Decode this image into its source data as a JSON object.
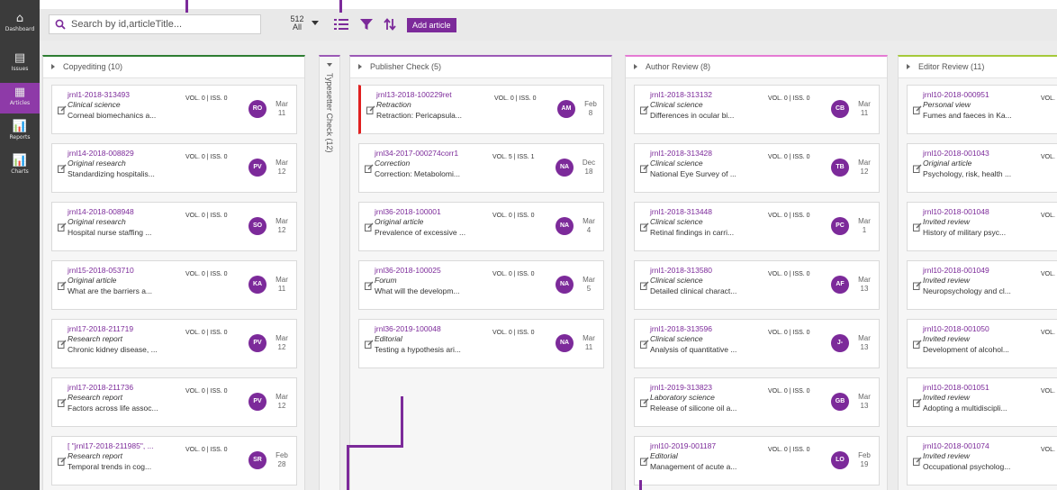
{
  "sidebar": {
    "items": [
      {
        "label": "Dashboard",
        "icon": "home-icon",
        "glyph": "⌂",
        "active": false
      },
      {
        "label": "Issues",
        "icon": "issues-icon",
        "glyph": "▤",
        "active": false
      },
      {
        "label": "Articles",
        "icon": "articles-icon",
        "glyph": "▦",
        "active": true
      },
      {
        "label": "Reports",
        "icon": "reports-icon",
        "glyph": "📊",
        "active": false
      },
      {
        "label": "Charts",
        "icon": "charts-icon",
        "glyph": "📊",
        "active": false
      }
    ]
  },
  "toolbar": {
    "search_placeholder": "Search by id,articleTitle...",
    "count_value": "512",
    "count_filter": "All",
    "add_label": "Add article"
  },
  "columns": [
    {
      "title": "Copyediting (10)",
      "accent": "#2e7d32",
      "cards": [
        {
          "id": "jrnl1-2018-313493",
          "type": "Clinical science",
          "title": "Corneal biomechanics a...",
          "vol": "VOL. 0 | ISS. 0",
          "avatar": "RO",
          "month": "Mar",
          "day": "11"
        },
        {
          "id": "jrnl14-2018-008829",
          "type": "Original research",
          "title": "Standardizing hospitalis...",
          "vol": "VOL. 0 | ISS. 0",
          "avatar": "PV",
          "month": "Mar",
          "day": "12"
        },
        {
          "id": "jrnl14-2018-008948",
          "type": "Original research",
          "title": "Hospital nurse staffing ...",
          "vol": "VOL. 0 | ISS. 0",
          "avatar": "SO",
          "month": "Mar",
          "day": "12"
        },
        {
          "id": "jrnl15-2018-053710",
          "type": "Original article",
          "title": "What are the barriers a...",
          "vol": "VOL. 0 | ISS. 0",
          "avatar": "KA",
          "month": "Mar",
          "day": "11"
        },
        {
          "id": "jrnl17-2018-211719",
          "type": "Research report",
          "title": "Chronic kidney disease, ...",
          "vol": "VOL. 0 | ISS. 0",
          "avatar": "PV",
          "month": "Mar",
          "day": "12"
        },
        {
          "id": "jrnl17-2018-211736",
          "type": "Research report",
          "title": "Factors across life assoc...",
          "vol": "VOL. 0 | ISS. 0",
          "avatar": "PV",
          "month": "Mar",
          "day": "12"
        },
        {
          "id": "[ \"jrnl17-2018-211985\", ...",
          "type": "Research report",
          "title": "Temporal trends in cog...",
          "vol": "VOL. 0 | ISS. 0",
          "avatar": "SR",
          "month": "Feb",
          "day": "28"
        }
      ]
    },
    {
      "title": "Publisher Check (5)",
      "accent": "#9b59b6",
      "cards": [
        {
          "id": "jrnl13-2018-100229ret",
          "type": "Retraction",
          "title": "Retraction: Pericapsula...",
          "vol": "VOL. 0 | ISS. 0",
          "avatar": "AM",
          "month": "Feb",
          "day": "8",
          "flag": true
        },
        {
          "id": "jrnl34-2017-000274corr1",
          "type": "Correction",
          "title": "Correction: Metabolomi...",
          "vol": "VOL. 5 | ISS. 1",
          "avatar": "NA",
          "month": "Dec",
          "day": "18"
        },
        {
          "id": "jrnl36-2018-100001",
          "type": "Original article",
          "title": "Prevalence of excessive ...",
          "vol": "VOL. 0 | ISS. 0",
          "avatar": "NA",
          "month": "Mar",
          "day": "4"
        },
        {
          "id": "jrnl36-2018-100025",
          "type": "Forum",
          "title": "What will the developm...",
          "vol": "VOL. 0 | ISS. 0",
          "avatar": "NA",
          "month": "Mar",
          "day": "5"
        },
        {
          "id": "jrnl36-2019-100048",
          "type": "Editorial",
          "title": "Testing a hypothesis ari...",
          "vol": "VOL. 0 | ISS. 0",
          "avatar": "NA",
          "month": "Mar",
          "day": "11"
        }
      ]
    },
    {
      "title": "Author Review (8)",
      "accent": "#e57bd3",
      "cards": [
        {
          "id": "jrnl1-2018-313132",
          "type": "Clinical science",
          "title": "Differences in ocular bi...",
          "vol": "VOL. 0 | ISS. 0",
          "avatar": "CB",
          "month": "Mar",
          "day": "11"
        },
        {
          "id": "jrnl1-2018-313428",
          "type": "Clinical science",
          "title": "National Eye Survey of ...",
          "vol": "VOL. 0 | ISS. 0",
          "avatar": "TB",
          "month": "Mar",
          "day": "12"
        },
        {
          "id": "jrnl1-2018-313448",
          "type": "Clinical science",
          "title": "Retinal findings in carri...",
          "vol": "VOL. 0 | ISS. 0",
          "avatar": "PC",
          "month": "Mar",
          "day": "1"
        },
        {
          "id": "jrnl1-2018-313580",
          "type": "Clinical science",
          "title": "Detailed clinical charact...",
          "vol": "VOL. 0 | ISS. 0",
          "avatar": "AF",
          "month": "Mar",
          "day": "13"
        },
        {
          "id": "jrnl1-2018-313596",
          "type": "Clinical science",
          "title": "Analysis of quantitative ...",
          "vol": "VOL. 0 | ISS. 0",
          "avatar": "J-",
          "month": "Mar",
          "day": "13"
        },
        {
          "id": "jrnl1-2019-313823",
          "type": "Laboratory science",
          "title": "Release of silicone oil a...",
          "vol": "VOL. 0 | ISS. 0",
          "avatar": "GB",
          "month": "Mar",
          "day": "13"
        },
        {
          "id": "jrnl10-2019-001187",
          "type": "Editorial",
          "title": "Management of acute a...",
          "vol": "VOL. 0 | ISS. 0",
          "avatar": "LO",
          "month": "Feb",
          "day": "19"
        }
      ]
    },
    {
      "title": "Editor Review (11)",
      "accent": "#a5c93a",
      "cards": [
        {
          "id": "jrnl10-2018-000951",
          "type": "Personal view",
          "title": "Fumes and faeces in Ka...",
          "vol": "VOL.",
          "avatar": "",
          "month": "",
          "day": ""
        },
        {
          "id": "jrnl10-2018-001043",
          "type": "Original article",
          "title": "Psychology, risk, health ...",
          "vol": "VOL.",
          "avatar": "",
          "month": "",
          "day": ""
        },
        {
          "id": "jrnl10-2018-001048",
          "type": "Invited review",
          "title": "History of military psyc...",
          "vol": "VOL.",
          "avatar": "",
          "month": "",
          "day": ""
        },
        {
          "id": "jrnl10-2018-001049",
          "type": "Invited review",
          "title": "Neuropsychology and cl...",
          "vol": "VOL.",
          "avatar": "",
          "month": "",
          "day": ""
        },
        {
          "id": "jrnl10-2018-001050",
          "type": "Invited review",
          "title": "Development of alcohol...",
          "vol": "VOL.",
          "avatar": "",
          "month": "",
          "day": ""
        },
        {
          "id": "jrnl10-2018-001051",
          "type": "Invited review",
          "title": "Adopting a multidiscipli...",
          "vol": "VOL.",
          "avatar": "",
          "month": "",
          "day": ""
        },
        {
          "id": "jrnl10-2018-001074",
          "type": "Invited review",
          "title": "Occupational psycholog...",
          "vol": "VOL.",
          "avatar": "",
          "month": "",
          "day": ""
        }
      ]
    }
  ],
  "collapsed_column": {
    "title": "Typesetter Check (12)",
    "accent": "#9b59b6"
  }
}
